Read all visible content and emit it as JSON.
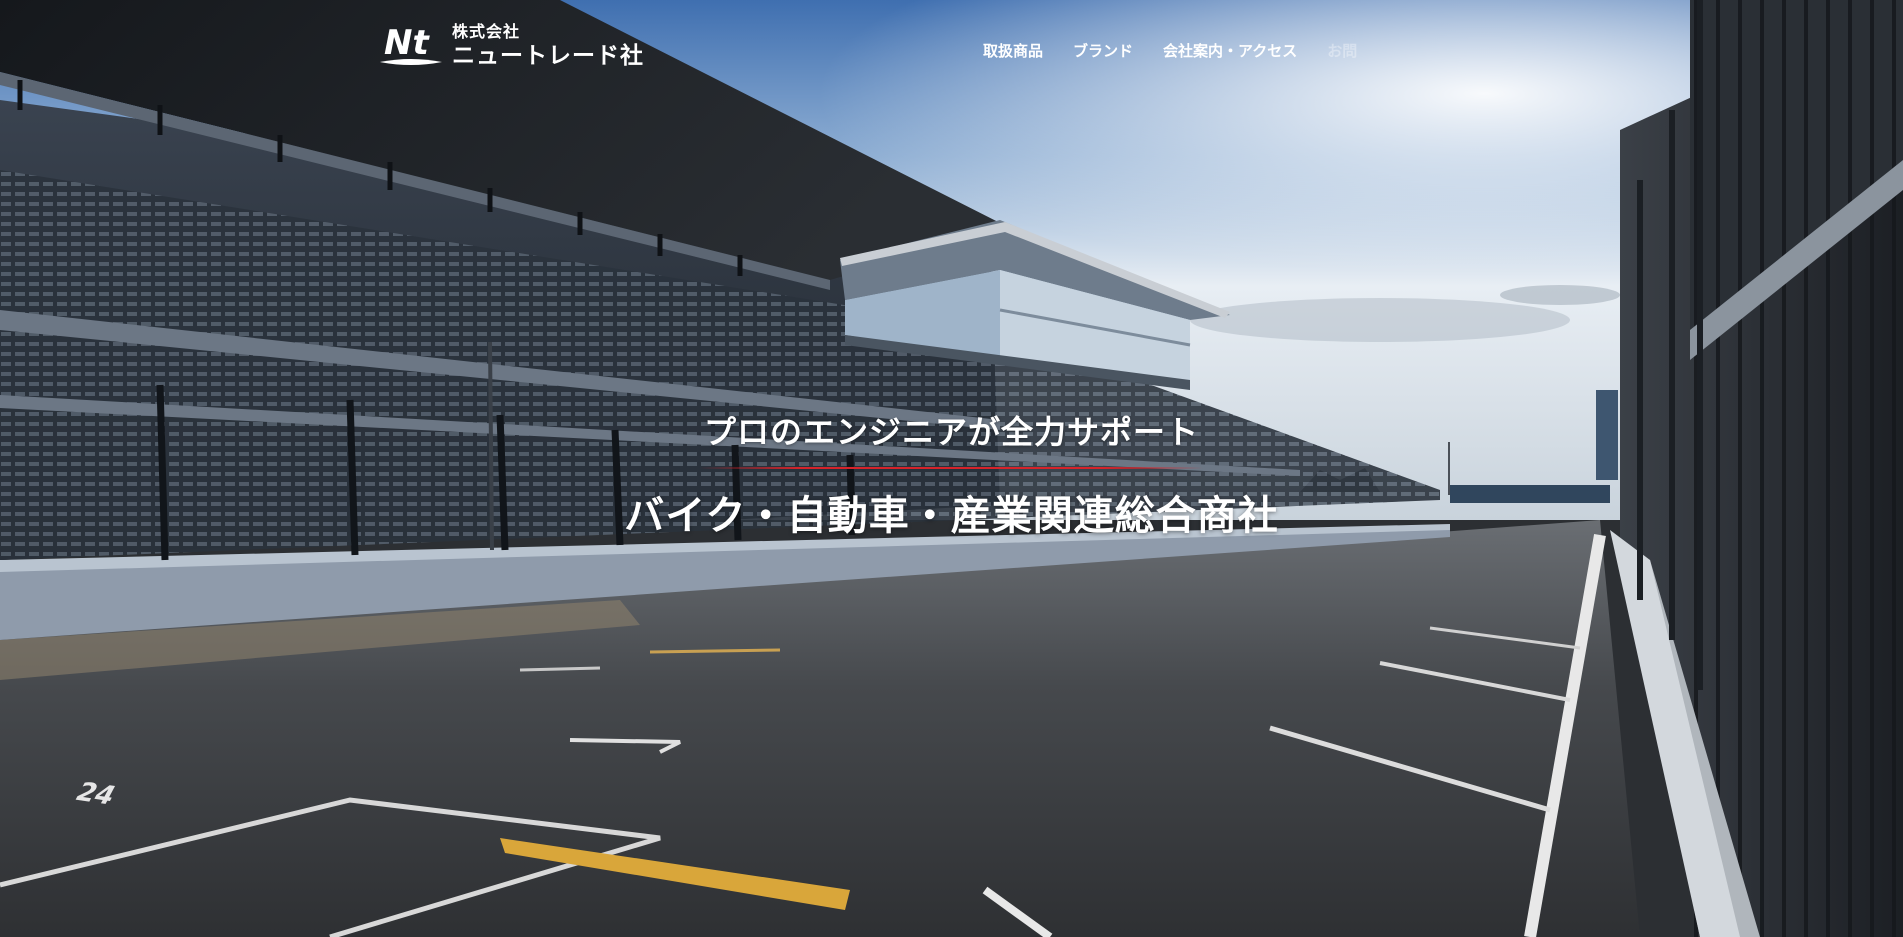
{
  "brand": {
    "company_type": "株式会社",
    "company_name": "ニュートレード社",
    "logo_mark": "Nt"
  },
  "nav": {
    "items": [
      {
        "label": "取扱商品"
      },
      {
        "label": "ブランド"
      },
      {
        "label": "会社案内・アクセス"
      },
      {
        "label": "お問"
      }
    ]
  },
  "hero": {
    "tagline": "プロのエンジニアが全力サポート",
    "headline": "バイク・自動車・産業関連総合商社",
    "pit_box_number": "24",
    "background": "race-track-grandstand-photo",
    "accent_color": "#d6232a"
  }
}
